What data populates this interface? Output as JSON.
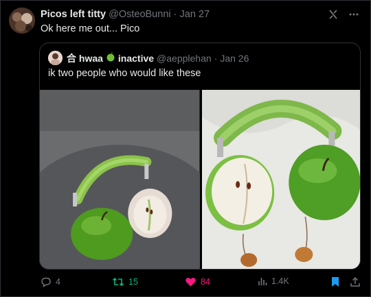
{
  "author": {
    "name": "Picos left titty",
    "handle": "@OsteoBunni",
    "sep": "·",
    "date": "Jan 27"
  },
  "tweet_text": "Ok here me out... Pico",
  "quote": {
    "name_prefix": "合 hwaa",
    "name_suffix": "inactive",
    "handle": "@aepplehan",
    "sep": "·",
    "date": "Jan 26",
    "text": "ik two people who would like these"
  },
  "actions": {
    "replies": "4",
    "reposts": "15",
    "likes": "84",
    "views": "1.4K"
  },
  "colors": {
    "bg": "#000000",
    "muted": "#71767b",
    "repost": "#00ba7c",
    "like": "#f91880",
    "bookmark": "#1d9bf0"
  },
  "icons": [
    "grok-icon",
    "more-icon",
    "reply-icon",
    "repost-icon",
    "heart-icon",
    "views-icon",
    "bookmark-icon",
    "share-icon"
  ]
}
